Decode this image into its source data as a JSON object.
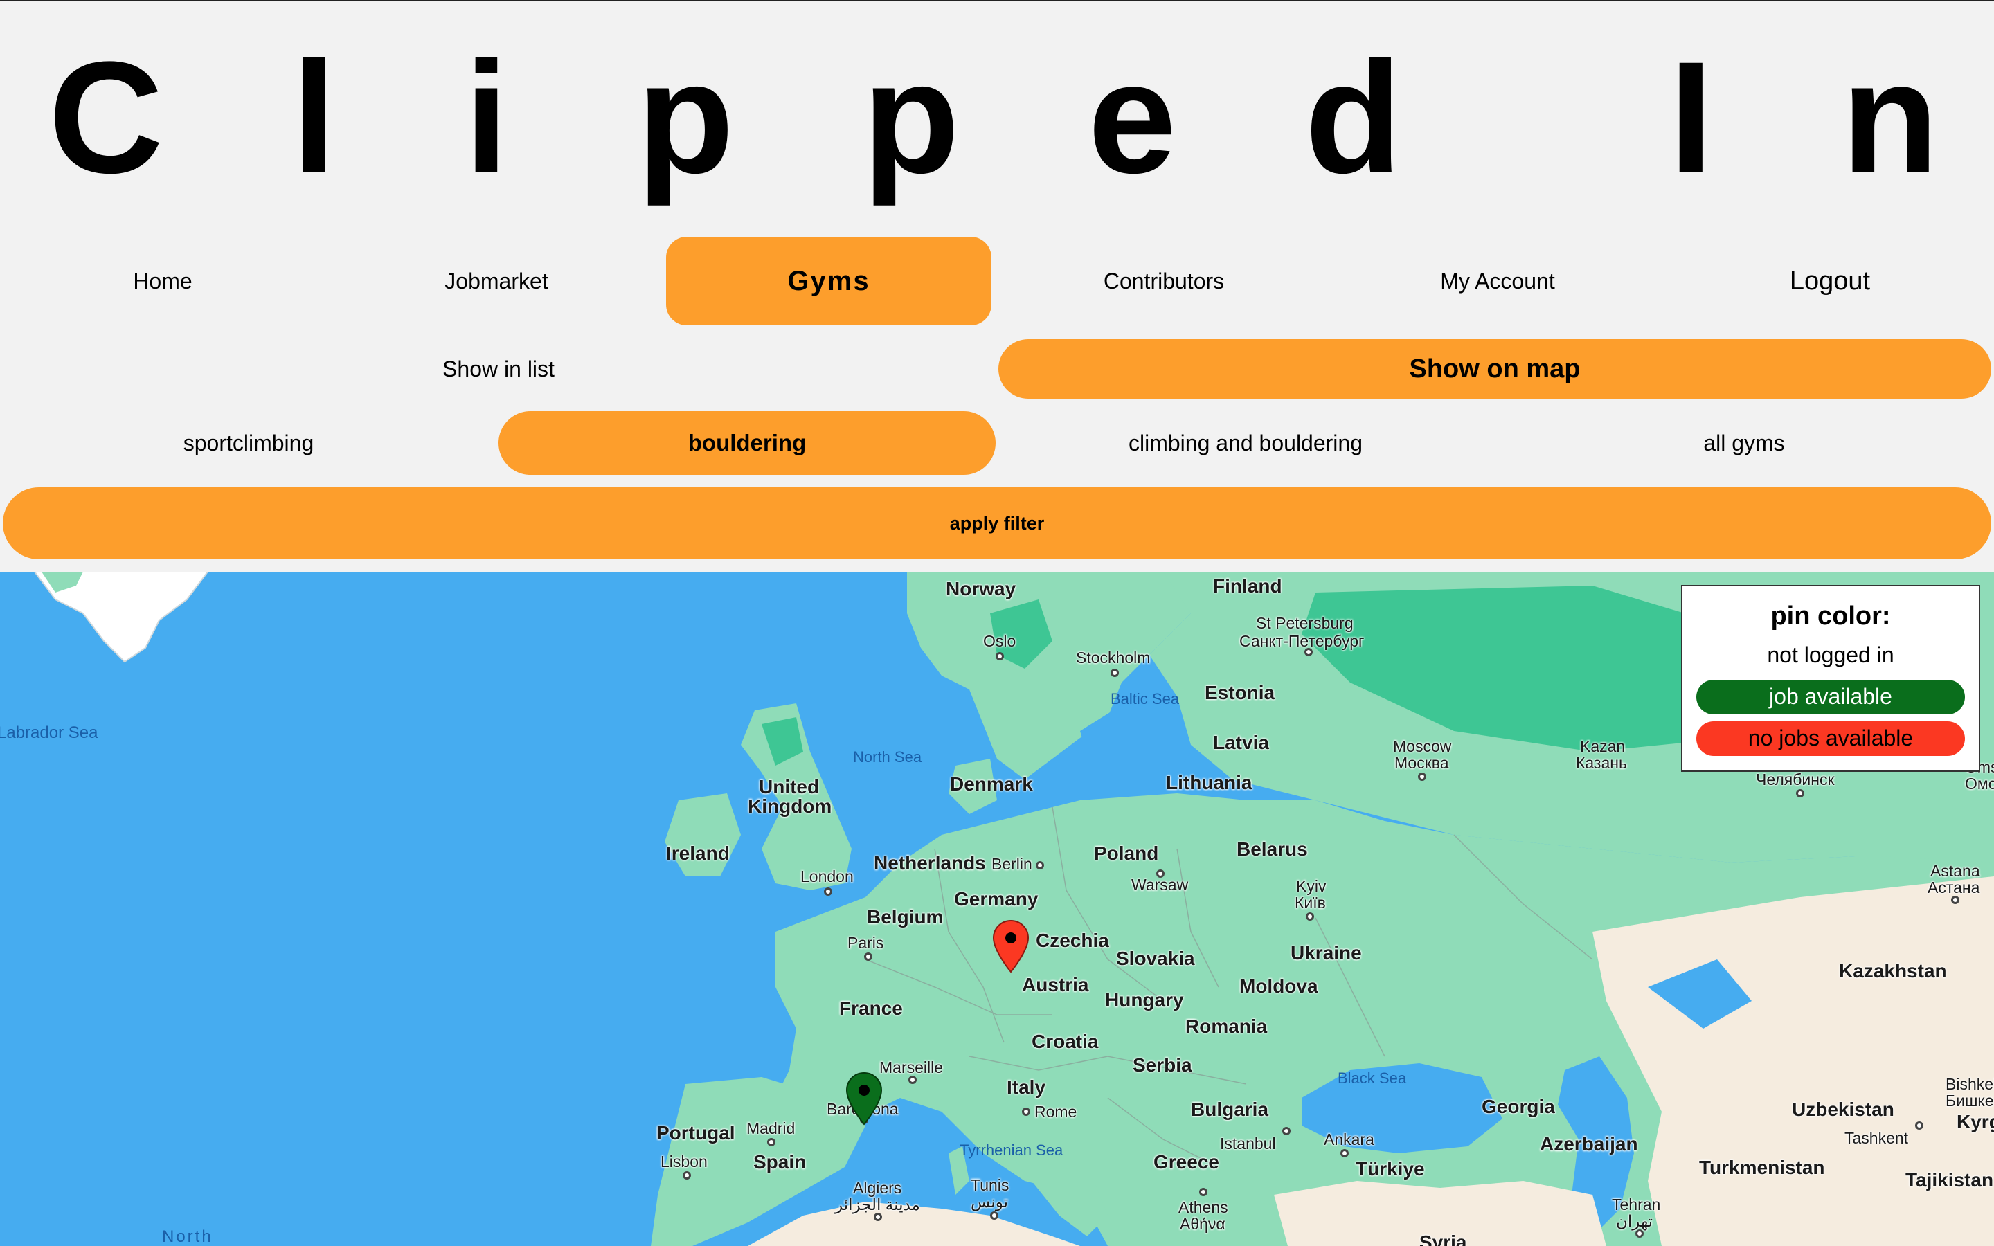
{
  "site_title_letters": [
    "C",
    "l",
    "i",
    "p",
    "p",
    "e",
    "d",
    "I",
    "n"
  ],
  "nav": {
    "home": "Home",
    "jobmarket": "Jobmarket",
    "gyms": "Gyms",
    "contributors": "Contributors",
    "my_account": "My Account",
    "logout": "Logout"
  },
  "view_toggle": {
    "list": "Show in list",
    "map": "Show on map",
    "active": "map"
  },
  "filters": {
    "sportclimbing": "sportclimbing",
    "bouldering": "bouldering",
    "climbing_and_bouldering": "climbing and bouldering",
    "all_gyms": "all gyms",
    "active": "bouldering",
    "apply": "apply filter"
  },
  "legend": {
    "title": "pin color:",
    "not_logged_in": "not logged in",
    "job_available": "job available",
    "no_jobs": "no jobs available",
    "job_color": "#0a6e1c",
    "no_job_color": "#fb3822"
  },
  "colors": {
    "accent": "#fd9e2c",
    "sea": "#46acf0",
    "land": "#8fdcb8"
  },
  "map": {
    "labels": {
      "norway": "Norway",
      "finland": "Finland",
      "st_petersburg": "St Petersburg",
      "st_petersburg_ru": "Санкт-Петербург",
      "oslo": "Oslo",
      "stockholm": "Stockholm",
      "baltic_sea": "Baltic Sea",
      "estonia": "Estonia",
      "labrador_sea": "Labrador Sea",
      "north_sea": "North Sea",
      "latvia": "Latvia",
      "moscow": "Moscow",
      "moscow_ru": "Москва",
      "kazan": "Kazan",
      "kazan_ru": "Казань",
      "chelyabinsk": "Челябинск",
      "united_kingdom_1": "United",
      "united_kingdom_2": "Kingdom",
      "denmark": "Denmark",
      "lithuania": "Lithuania",
      "ireland": "Ireland",
      "poland": "Poland",
      "belarus": "Belarus",
      "netherlands": "Netherlands",
      "berlin": "Berlin",
      "london": "London",
      "warsaw": "Warsaw",
      "kyiv": "Kyiv",
      "kyiv_ua": "Київ",
      "germany": "Germany",
      "belgium": "Belgium",
      "astana": "Astana",
      "astana_kz": "Астана",
      "paris": "Paris",
      "czechia": "Czechia",
      "slovakia": "Slovakia",
      "ukraine": "Ukraine",
      "austria": "Austria",
      "moldova": "Moldova",
      "kazakhstan": "Kazakhstan",
      "france": "France",
      "hungary": "Hungary",
      "romania": "Romania",
      "croatia": "Croatia",
      "marseille": "Marseille",
      "serbia": "Serbia",
      "black_sea": "Black Sea",
      "italy": "Italy",
      "barcelona": "Barcelona",
      "rome": "Rome",
      "bulgaria": "Bulgaria",
      "georgia": "Georgia",
      "uzbekistan": "Uzbekistan",
      "bishkek": "Bishkek",
      "bishkek_kg": "Бишкек",
      "portugal": "Portugal",
      "madrid": "Madrid",
      "spain": "Spain",
      "istanbul": "Istanbul",
      "ankara": "Ankara",
      "azerbaijan": "Azerbaijan",
      "tashkent": "Tashkent",
      "kyrgyz": "Kyrg",
      "lisbon": "Lisbon",
      "tyrrhenian_sea": "Tyrrhenian Sea",
      "greece": "Greece",
      "turkiye": "Türkiye",
      "turkmenistan": "Turkmenistan",
      "tajikistan": "Tajikistan",
      "algiers": "Algiers",
      "algiers_ar": "مدينة الجزائر",
      "tunis": "Tunis",
      "tunis_ar": "تونس",
      "athens": "Athens",
      "athens_gr": "Αθήνα",
      "tehran": "Tehran",
      "tehran_fa": "تهران",
      "north": "North",
      "syria": "Syria",
      "omsk": "Oms",
      "omsk_ru": "Омс"
    },
    "pins": [
      {
        "name": "pin-bouldering-gym-germany",
        "status": "no_jobs"
      },
      {
        "name": "pin-bouldering-gym-barcelona",
        "status": "job_available"
      }
    ]
  }
}
